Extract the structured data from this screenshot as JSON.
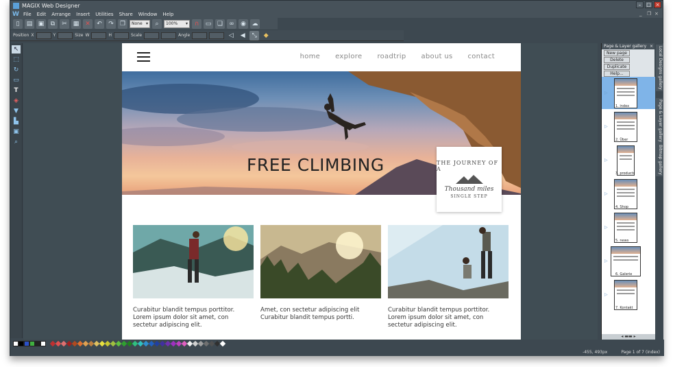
{
  "app": {
    "title": "MAGIX Web Designer"
  },
  "menu": [
    "File",
    "Edit",
    "Arrange",
    "Insert",
    "Utilities",
    "Share",
    "Window",
    "Help"
  ],
  "toolbar": {
    "quality_value": "None",
    "zoom_value": "100%"
  },
  "infobar": {
    "position_label": "Position",
    "x_label": "X",
    "y_label": "Y",
    "size_label": "Size",
    "w_label": "W",
    "h_label": "H",
    "scale_label": "Scale",
    "angle_label": "Angle"
  },
  "site": {
    "nav": [
      "home",
      "explore",
      "roadtrip",
      "about us",
      "contact"
    ],
    "hero_title": "FREE CLIMBING",
    "badge": {
      "line1": "THE JOURNEY OF A",
      "line2": "Thousand miles",
      "line3": "SINGLE STEP"
    },
    "cards": [
      {
        "text": "Curabitur blandit tempus porttitor. Lorem ipsum dolor sit amet, con sectetur adipiscing elit."
      },
      {
        "text": "Amet, con sectetur adipiscing elit Curabitur blandit tempus portti."
      },
      {
        "text": "Curabitur blandit tempus porttitor. Lorem ipsum dolor sit amet, con sectetur adipiscing elit."
      }
    ]
  },
  "panel": {
    "title": "Page & Layer gallery",
    "buttons": [
      "New page",
      "Delete",
      "Duplicate",
      "Help..."
    ],
    "pages": [
      "1. index",
      "2. Über",
      "3. products",
      "4. Shop",
      "5. news",
      "6. Galerie",
      "7. Kontakt"
    ],
    "side_tabs": [
      "Local Designs gallery",
      "Page & Layer gallery",
      "Bitmap gallery"
    ]
  },
  "status": {
    "coords": "-455, 493px",
    "page_info": "Page 1 of 7 (index)"
  },
  "colors": {
    "canvas_bg": "#404d54",
    "accent": "#7fb4e8"
  }
}
